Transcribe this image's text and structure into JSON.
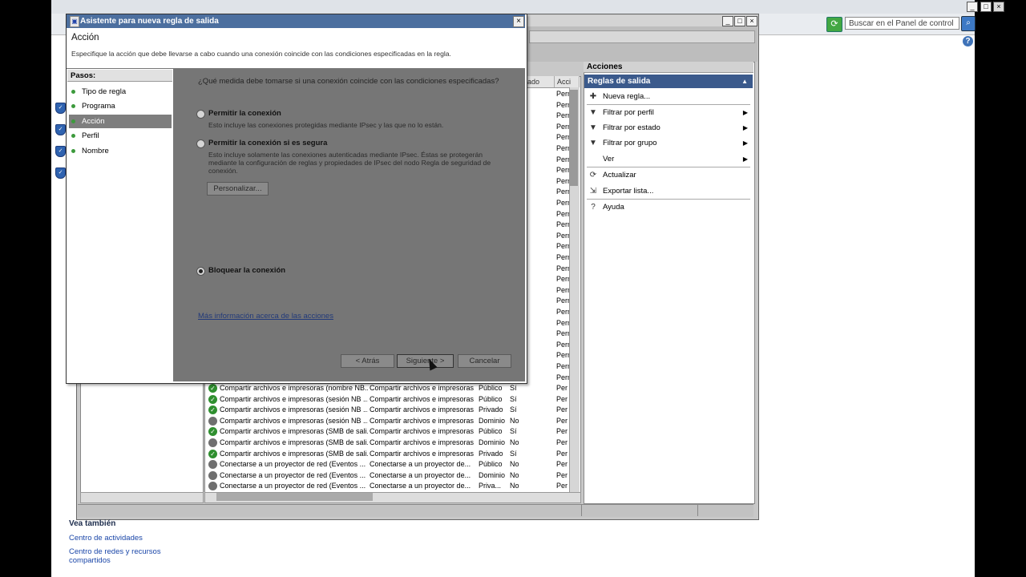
{
  "control_panel": {
    "search_placeholder": "Buscar en el Panel de control",
    "see_also_title": "Vea también",
    "see_also_links": [
      "Centro de actividades",
      "Centro de redes y recursos compartidos"
    ]
  },
  "mmc": {
    "list_header": {
      "col_profile": "ado",
      "col_action": "Acci"
    },
    "rows": [
      {
        "name": "Compartir archivos e impresoras (nombre NB...",
        "group": "Compartir archivos e impresoras",
        "profile": "Público",
        "enabled": "Sí",
        "action": "Perm",
        "on": true
      },
      {
        "name": "Compartir archivos e impresoras (sesión NB ...",
        "group": "Compartir archivos e impresoras",
        "profile": "Público",
        "enabled": "Sí",
        "action": "Perm",
        "on": true
      },
      {
        "name": "Compartir archivos e impresoras (sesión NB ...",
        "group": "Compartir archivos e impresoras",
        "profile": "Privado",
        "enabled": "Sí",
        "action": "Perm",
        "on": true
      },
      {
        "name": "Compartir archivos e impresoras (sesión NB ...",
        "group": "Compartir archivos e impresoras",
        "profile": "Dominio",
        "enabled": "No",
        "action": "Perm",
        "on": false
      },
      {
        "name": "Compartir archivos e impresoras (SMB de sali...",
        "group": "Compartir archivos e impresoras",
        "profile": "Público",
        "enabled": "Sí",
        "action": "Perm",
        "on": true
      },
      {
        "name": "Compartir archivos e impresoras (SMB de sali...",
        "group": "Compartir archivos e impresoras",
        "profile": "Dominio",
        "enabled": "No",
        "action": "Perm",
        "on": false
      },
      {
        "name": "Compartir archivos e impresoras (SMB de sali...",
        "group": "Compartir archivos e impresoras",
        "profile": "Privado",
        "enabled": "Sí",
        "action": "Perm",
        "on": true
      },
      {
        "name": "Conectarse a un proyector de red (Eventos ...",
        "group": "Conectarse a un proyector de...",
        "profile": "Público",
        "enabled": "No",
        "action": "Perm",
        "on": false
      },
      {
        "name": "Conectarse a un proyector de red (Eventos ...",
        "group": "Conectarse a un proyector de...",
        "profile": "Dominio",
        "enabled": "No",
        "action": "Perm",
        "on": false
      },
      {
        "name": "Conectarse a un proyector de red (Eventos ...",
        "group": "Conectarse a un proyector de...",
        "profile": "Priva...",
        "enabled": "No",
        "action": "Perm",
        "on": false
      }
    ],
    "perm_label": "Perm",
    "actions": {
      "header": "Acciones",
      "section": "Reglas de salida",
      "items": [
        {
          "label": "Nueva regla...",
          "icon": "new-rule-icon",
          "submenu": false
        },
        {
          "label": "Filtrar por perfil",
          "icon": "filter-icon",
          "submenu": true
        },
        {
          "label": "Filtrar por estado",
          "icon": "filter-icon",
          "submenu": true
        },
        {
          "label": "Filtrar por grupo",
          "icon": "filter-icon",
          "submenu": true
        },
        {
          "label": "Ver",
          "icon": "",
          "submenu": true
        },
        {
          "label": "Actualizar",
          "icon": "refresh-icon",
          "submenu": false
        },
        {
          "label": "Exportar lista...",
          "icon": "export-icon",
          "submenu": false
        },
        {
          "label": "Ayuda",
          "icon": "help-book-icon",
          "submenu": false
        }
      ]
    }
  },
  "wizard": {
    "title": "Asistente para nueva regla de salida",
    "heading": "Acción",
    "description": "Especifique la acción que debe llevarse a cabo cuando una conexión coincide con las condiciones especificadas en la regla.",
    "steps_header": "Pasos:",
    "steps": [
      "Tipo de regla",
      "Programa",
      "Acción",
      "Perfil",
      "Nombre"
    ],
    "active_step": "Acción",
    "question": "¿Qué medida debe tomarse si una conexión coincide con las condiciones especificadas?",
    "options": [
      {
        "label": "Permitir la conexión",
        "desc": "Esto incluye las conexiones protegidas mediante IPsec y las que no lo están.",
        "selected": false
      },
      {
        "label": "Permitir la conexión si es segura",
        "desc": "Esto incluye solamente las conexiones autenticadas mediante IPsec. Éstas se protegerán mediante la configuración de reglas y propiedades de IPsec del nodo Regla de seguridad de conexión.",
        "selected": false
      },
      {
        "label": "Bloquear la conexión",
        "desc": "",
        "selected": true
      }
    ],
    "customize_button": "Personalizar...",
    "more_info_link": "Más información acerca de las acciones",
    "back_button": "< Atrás",
    "next_button": "Siguiente >",
    "cancel_button": "Cancelar"
  }
}
